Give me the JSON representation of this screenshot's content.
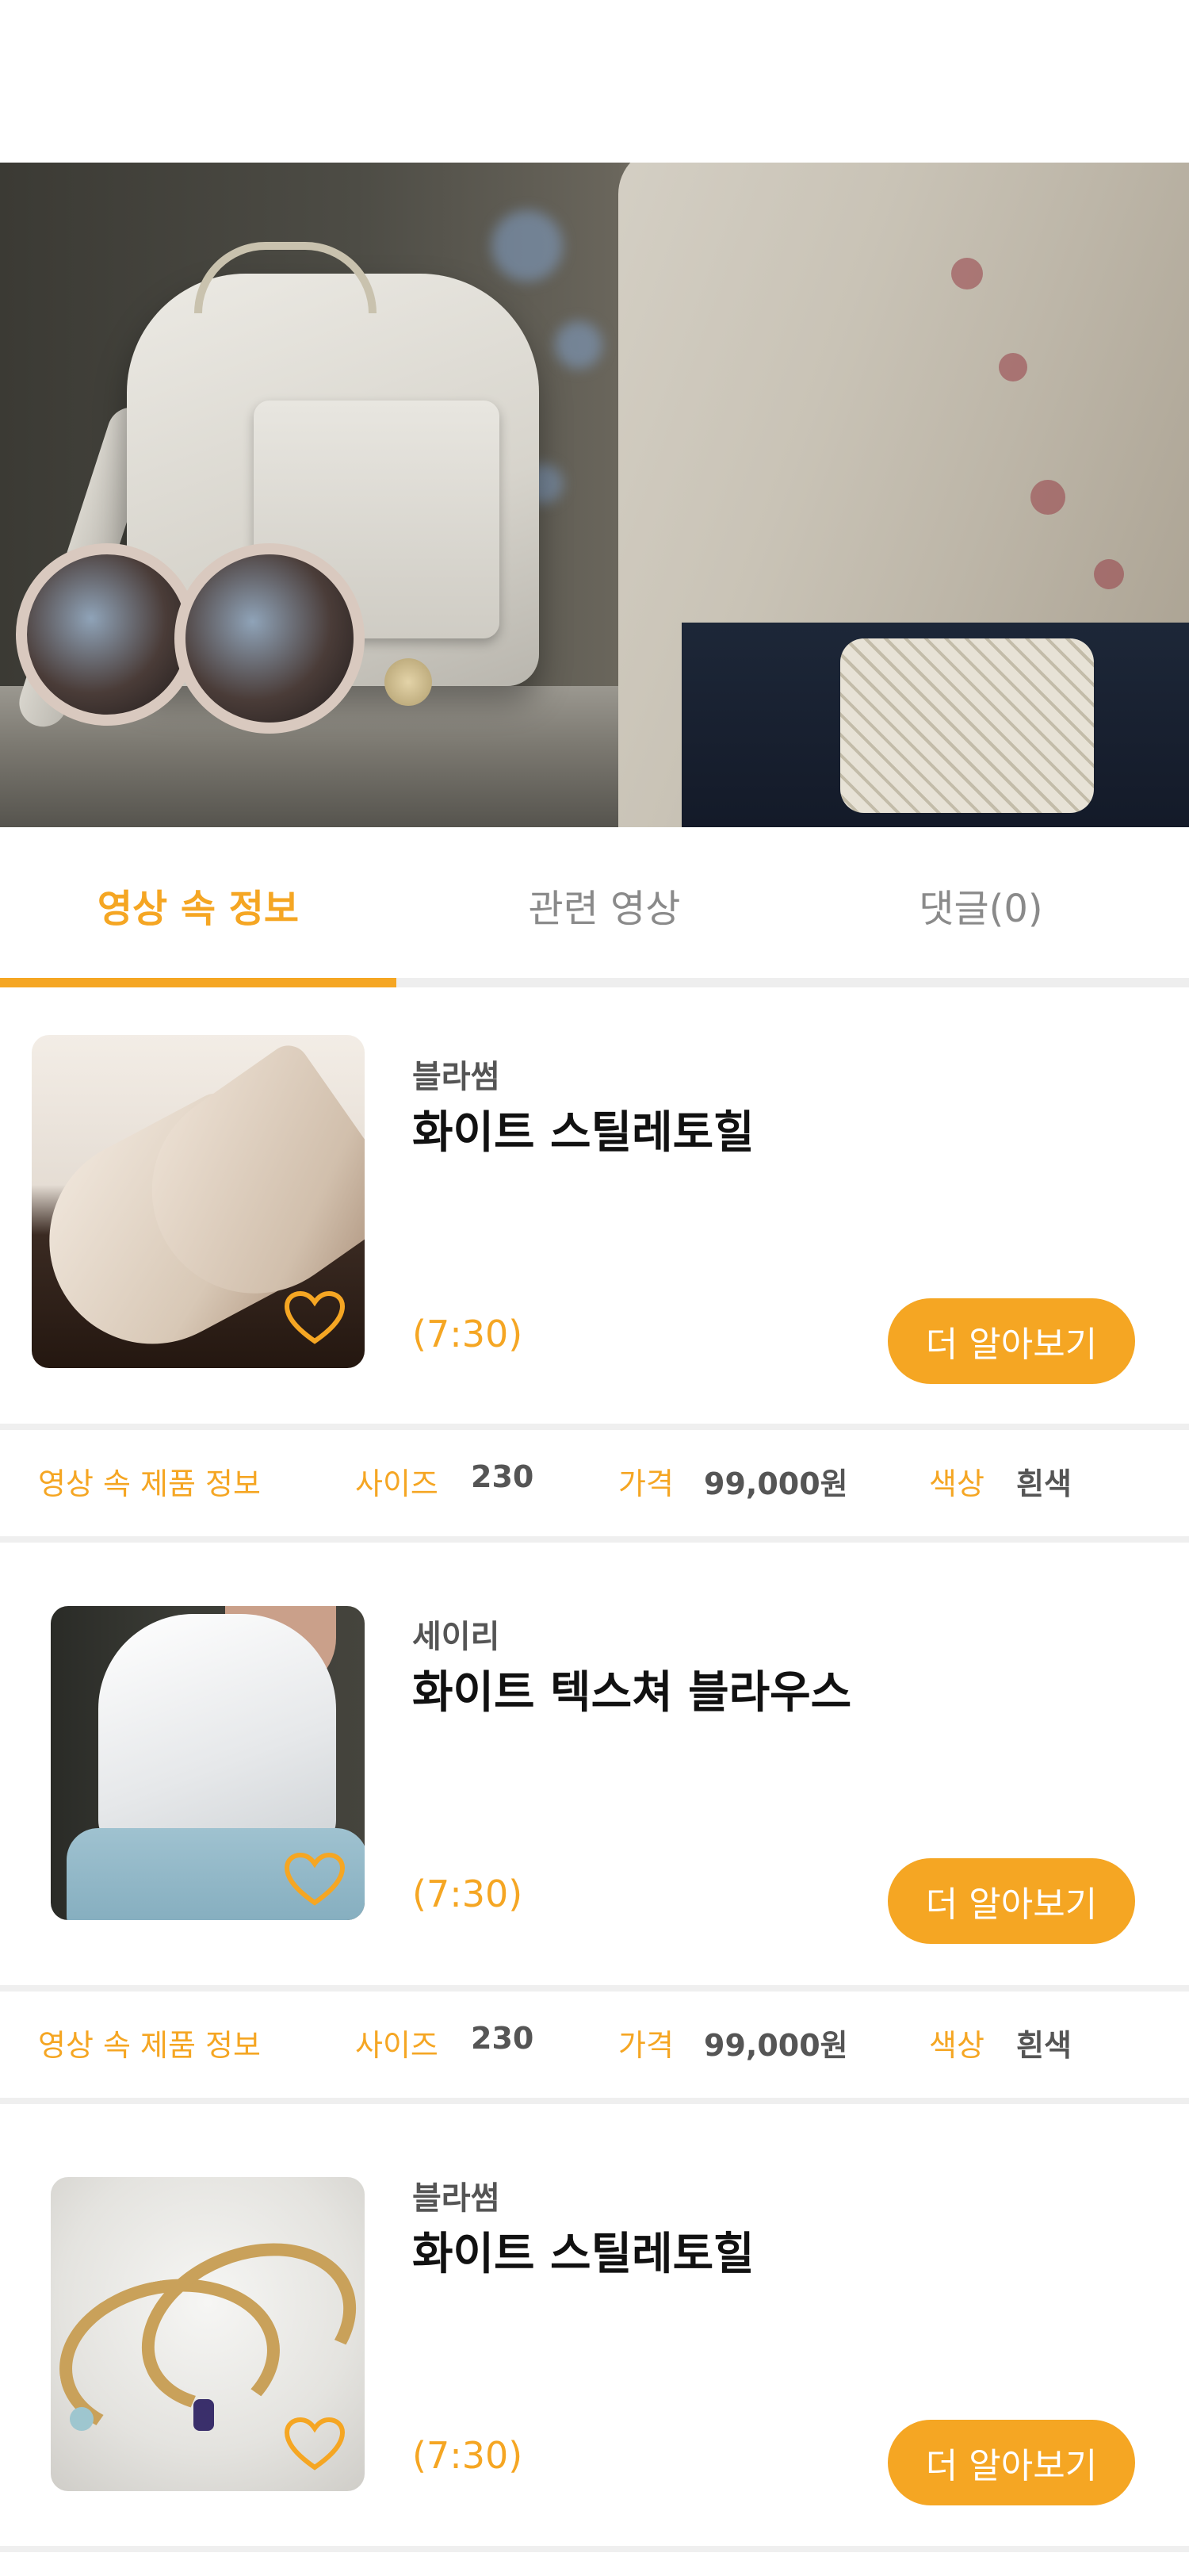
{
  "tabs": [
    {
      "label": "영상 속 정보",
      "active": true
    },
    {
      "label": "관련 영상",
      "active": false
    },
    {
      "label": "댓글(0)",
      "active": false
    }
  ],
  "colors": {
    "accent": "#f5a623",
    "text": "#111111",
    "muted": "#8a8a8a"
  },
  "products": [
    {
      "brand": "블라썸",
      "name": "화이트 스틸레토힐",
      "time": "(7:30)",
      "button": "더 알아보기"
    },
    {
      "brand": "세이리",
      "name": "화이트 텍스쳐 블라우스",
      "time": "(7:30)",
      "button": "더 알아보기"
    },
    {
      "brand": "블라썸",
      "name": "화이트 스틸레토힐",
      "time": "(7:30)",
      "button": "더 알아보기"
    }
  ],
  "info_bars": [
    {
      "title": "영상 속 제품 정보",
      "size_label": "사이즈",
      "size": "230",
      "price_label": "가격",
      "price": "99,000원",
      "color_label": "색상",
      "color": "흰색"
    },
    {
      "title": "영상 속 제품 정보",
      "size_label": "사이즈",
      "size": "230",
      "price_label": "가격",
      "price": "99,000원",
      "color_label": "색상",
      "color": "흰색"
    }
  ]
}
